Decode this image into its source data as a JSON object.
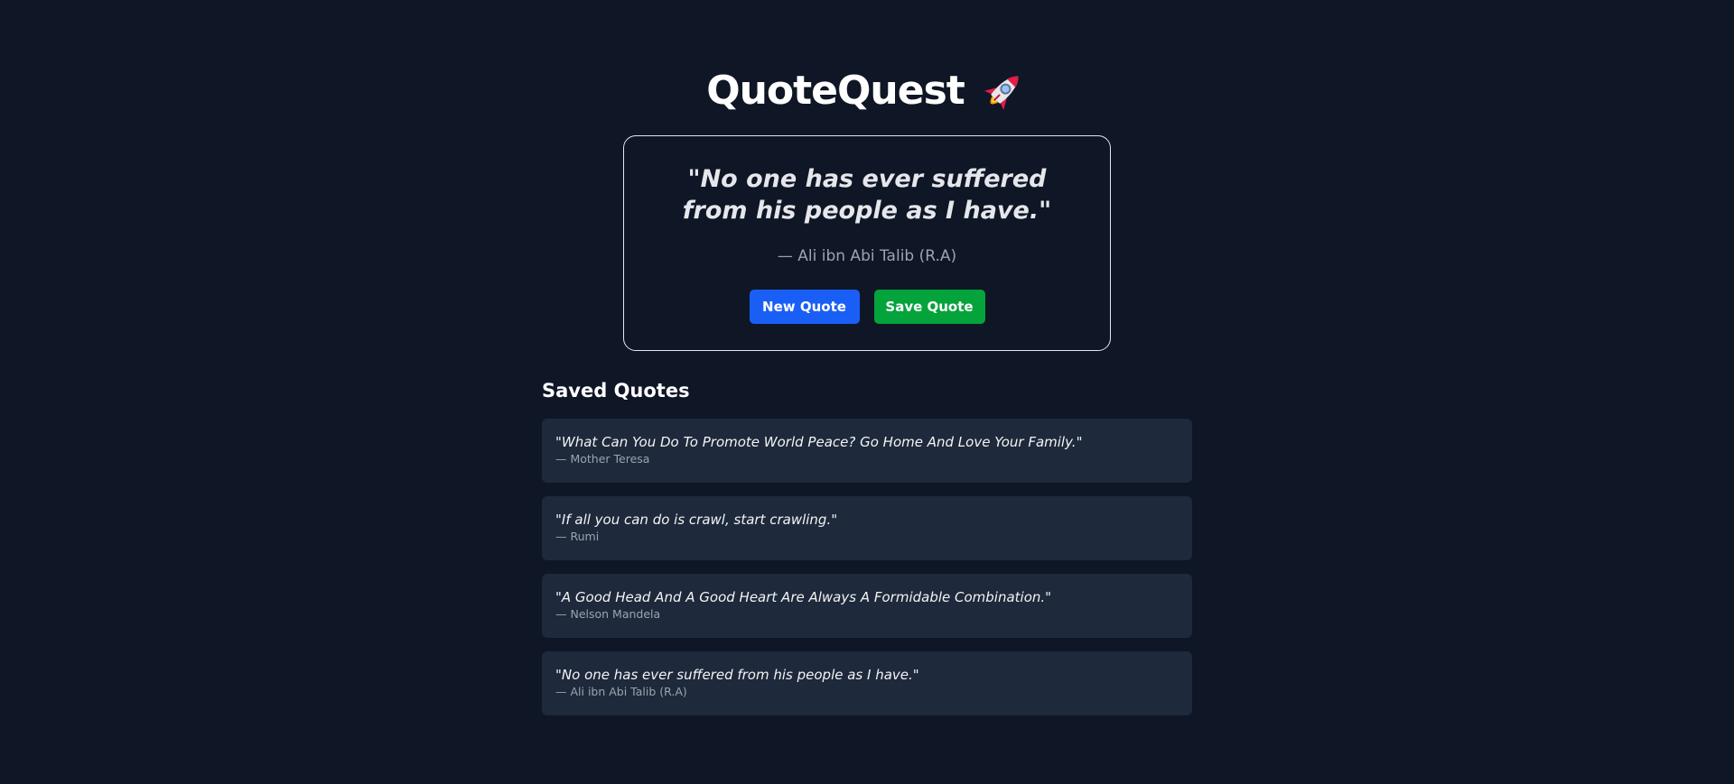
{
  "app": {
    "title": "QuoteQuest",
    "title_icon": "rocket-icon"
  },
  "current_quote": {
    "text": "\"No one has ever suffered from his people as I have.\"",
    "author": "— Ali ibn Abi Talib (R.A)"
  },
  "actions": {
    "new_quote_label": "New Quote",
    "save_quote_label": "Save Quote"
  },
  "saved": {
    "heading": "Saved Quotes",
    "items": [
      {
        "text": "\"What Can You Do To Promote World Peace? Go Home And Love Your Family.\"",
        "author": "— Mother Teresa"
      },
      {
        "text": "\"If all you can do is crawl, start crawling.\"",
        "author": "— Rumi"
      },
      {
        "text": "\"A Good Head And A Good Heart Are Always A Formidable Combination.\"",
        "author": "— Nelson Mandela"
      },
      {
        "text": "\"No one has ever suffered from his people as I have.\"",
        "author": "— Ali ibn Abi Talib (R.A)"
      }
    ]
  },
  "colors": {
    "background": "#0f1626",
    "card_border": "#e5e7eb",
    "saved_item_bg": "#1e293b",
    "new_quote_button": "#1a5ff5",
    "save_quote_button": "#05a33b",
    "muted_text": "#9ca3af"
  }
}
